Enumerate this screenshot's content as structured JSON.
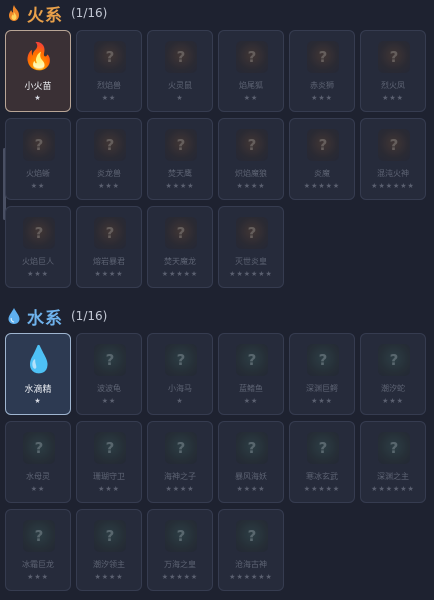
{
  "colors": {
    "background": "#1e2230",
    "fire": "#e8a04a",
    "water": "#6fb2ec"
  },
  "fire": {
    "icon": "fire-icon",
    "title": "火系",
    "count": "(1/16)",
    "cards": [
      {
        "name": "小火苗",
        "stars": "★",
        "unlocked": true,
        "glyph": "🔥"
      },
      {
        "name": "烈焰兽",
        "stars": "★★",
        "unlocked": false,
        "glyph": "?"
      },
      {
        "name": "火灵鼠",
        "stars": "★",
        "unlocked": false,
        "glyph": "?"
      },
      {
        "name": "焰尾狐",
        "stars": "★★",
        "unlocked": false,
        "glyph": "?"
      },
      {
        "name": "赤炎狮",
        "stars": "★★★",
        "unlocked": false,
        "glyph": "?"
      },
      {
        "name": "烈火凤",
        "stars": "★★★",
        "unlocked": false,
        "glyph": "?"
      },
      {
        "name": "火焰蜥",
        "stars": "★★",
        "unlocked": false,
        "glyph": "?"
      },
      {
        "name": "炎龙兽",
        "stars": "★★★",
        "unlocked": false,
        "glyph": "?"
      },
      {
        "name": "焚天鹰",
        "stars": "★★★★",
        "unlocked": false,
        "glyph": "?"
      },
      {
        "name": "炽焰魔狼",
        "stars": "★★★★",
        "unlocked": false,
        "glyph": "?"
      },
      {
        "name": "炎魔",
        "stars": "★★★★★",
        "unlocked": false,
        "glyph": "?"
      },
      {
        "name": "混沌火神",
        "stars": "★★★★★★",
        "unlocked": false,
        "glyph": "?"
      },
      {
        "name": "火焰巨人",
        "stars": "★★★",
        "unlocked": false,
        "glyph": "?"
      },
      {
        "name": "熔岩暴君",
        "stars": "★★★★",
        "unlocked": false,
        "glyph": "?"
      },
      {
        "name": "焚天魔龙",
        "stars": "★★★★★",
        "unlocked": false,
        "glyph": "?"
      },
      {
        "name": "灭世炎皇",
        "stars": "★★★★★★",
        "unlocked": false,
        "glyph": "?"
      }
    ]
  },
  "water": {
    "icon": "water-drop-icon",
    "title": "水系",
    "count": "(1/16)",
    "cards": [
      {
        "name": "水滴精",
        "stars": "★",
        "unlocked": true,
        "glyph": "💧"
      },
      {
        "name": "波波龟",
        "stars": "★★",
        "unlocked": false,
        "glyph": "?"
      },
      {
        "name": "小海马",
        "stars": "★",
        "unlocked": false,
        "glyph": "?"
      },
      {
        "name": "蓝鳍鱼",
        "stars": "★★",
        "unlocked": false,
        "glyph": "?"
      },
      {
        "name": "深渊巨鳄",
        "stars": "★★★",
        "unlocked": false,
        "glyph": "?"
      },
      {
        "name": "潮汐蛇",
        "stars": "★★★",
        "unlocked": false,
        "glyph": "?"
      },
      {
        "name": "水母灵",
        "stars": "★★",
        "unlocked": false,
        "glyph": "?"
      },
      {
        "name": "珊瑚守卫",
        "stars": "★★★",
        "unlocked": false,
        "glyph": "?"
      },
      {
        "name": "海神之子",
        "stars": "★★★★",
        "unlocked": false,
        "glyph": "?"
      },
      {
        "name": "暴风海妖",
        "stars": "★★★★",
        "unlocked": false,
        "glyph": "?"
      },
      {
        "name": "寒冰玄武",
        "stars": "★★★★★",
        "unlocked": false,
        "glyph": "?"
      },
      {
        "name": "深渊之主",
        "stars": "★★★★★★",
        "unlocked": false,
        "glyph": "?"
      },
      {
        "name": "冰霜巨龙",
        "stars": "★★★",
        "unlocked": false,
        "glyph": "?"
      },
      {
        "name": "潮汐领主",
        "stars": "★★★★",
        "unlocked": false,
        "glyph": "?"
      },
      {
        "name": "万海之皇",
        "stars": "★★★★★",
        "unlocked": false,
        "glyph": "?"
      },
      {
        "name": "沧海古神",
        "stars": "★★★★★★",
        "unlocked": false,
        "glyph": "?"
      }
    ]
  }
}
